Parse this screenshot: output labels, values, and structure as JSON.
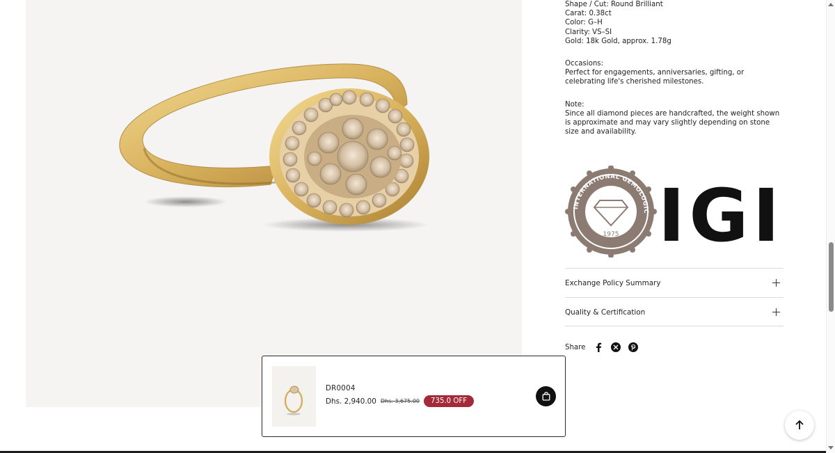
{
  "product": {
    "image_alt": "Diamond halo ring in 18k yellow gold",
    "specs": [
      "Shape / Cut: Round Brilliant",
      "Carat: 0.38ct",
      "Color: G–H",
      "Clarity: VS–SI",
      "Gold: 18k Gold, approx. 1.78g"
    ],
    "occasions_title": "Occasions:",
    "occasions_text": "Perfect for engagements, anniversaries, gifting, or celebrating life's cherished milestones.",
    "note_title": "Note:",
    "note_text": "Since all diamond pieces are handcrafted, the weight shown is approximate and may vary slightly depending on stone size and availability."
  },
  "certification_logo": {
    "seal_text": "INTERNATIONAL GEMOLOGICAL INSTITUTE",
    "year": "1975",
    "wordmark": "IGI",
    "seal_color": "#8c7b72"
  },
  "accordions": [
    {
      "label": "Exchange Policy Summary"
    },
    {
      "label": "Quality & Certification"
    }
  ],
  "share": {
    "label": "Share",
    "icons": [
      "facebook-icon",
      "x-icon",
      "pinterest-icon"
    ]
  },
  "sticky_cart": {
    "sku": "DR0004",
    "price": "Dhs. 2,940.00",
    "compare_price": "Dhs. 3,675.00",
    "discount_badge": "735.0 OFF",
    "badge_color": "#a32a38"
  }
}
